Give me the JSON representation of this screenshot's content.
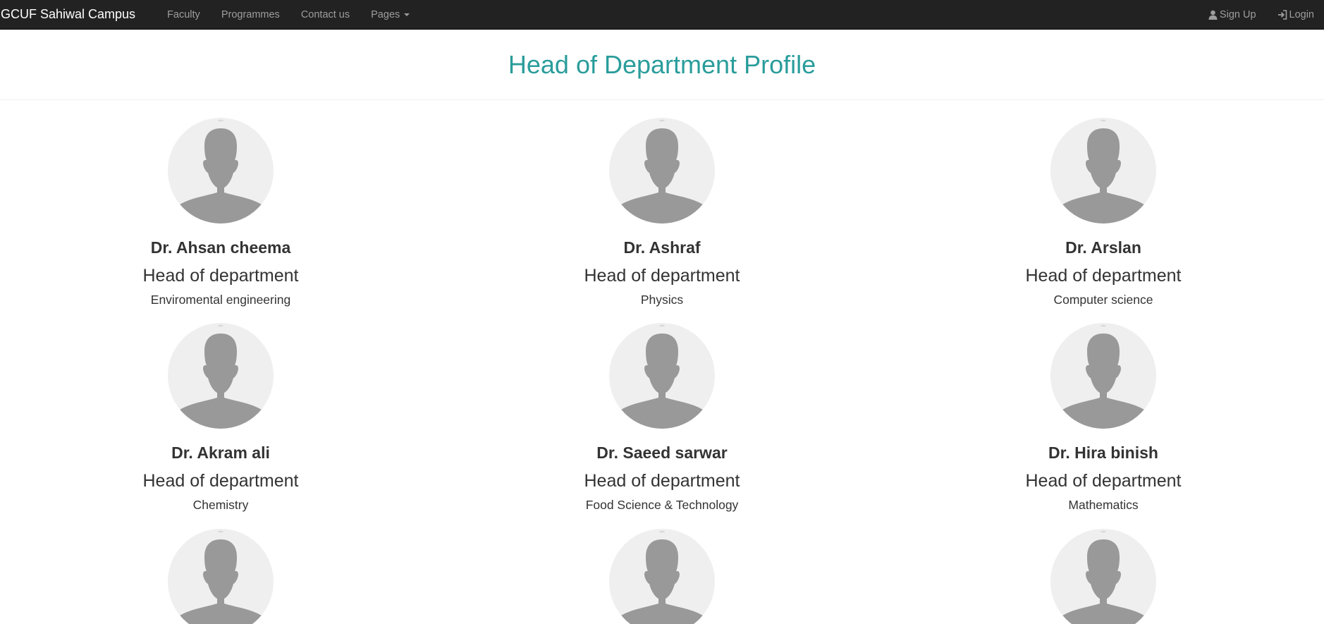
{
  "navbar": {
    "brand": "GCUF Sahiwal Campus",
    "links": [
      "Faculty",
      "Programmes",
      "Contact us",
      "Pages"
    ],
    "signup": "Sign Up",
    "login": "Login"
  },
  "page": {
    "title": "Head of Department Profile"
  },
  "profiles": [
    {
      "name": "Dr. Ahsan cheema",
      "role": "Head of department",
      "department": "Enviromental engineering"
    },
    {
      "name": "Dr. Ashraf",
      "role": "Head of department",
      "department": "Physics"
    },
    {
      "name": "Dr. Arslan",
      "role": "Head of department",
      "department": "Computer science"
    },
    {
      "name": "Dr. Akram ali",
      "role": "Head of department",
      "department": "Chemistry"
    },
    {
      "name": "Dr. Saeed sarwar",
      "role": "Head of department",
      "department": "Food Science & Technology"
    },
    {
      "name": "Dr. Hira binish",
      "role": "Head of department",
      "department": "Mathematics"
    },
    {
      "name": "",
      "role": "",
      "department": ""
    },
    {
      "name": "",
      "role": "",
      "department": ""
    },
    {
      "name": "",
      "role": "",
      "department": ""
    }
  ],
  "icons": {
    "avatar": "user-avatar-placeholder-icon",
    "signup": "user-icon",
    "login": "log-in-icon"
  },
  "colors": {
    "navbar_bg": "#222222",
    "title": "#2a9d9b",
    "avatar_bg": "#efefef",
    "avatar_fg": "#999999"
  }
}
